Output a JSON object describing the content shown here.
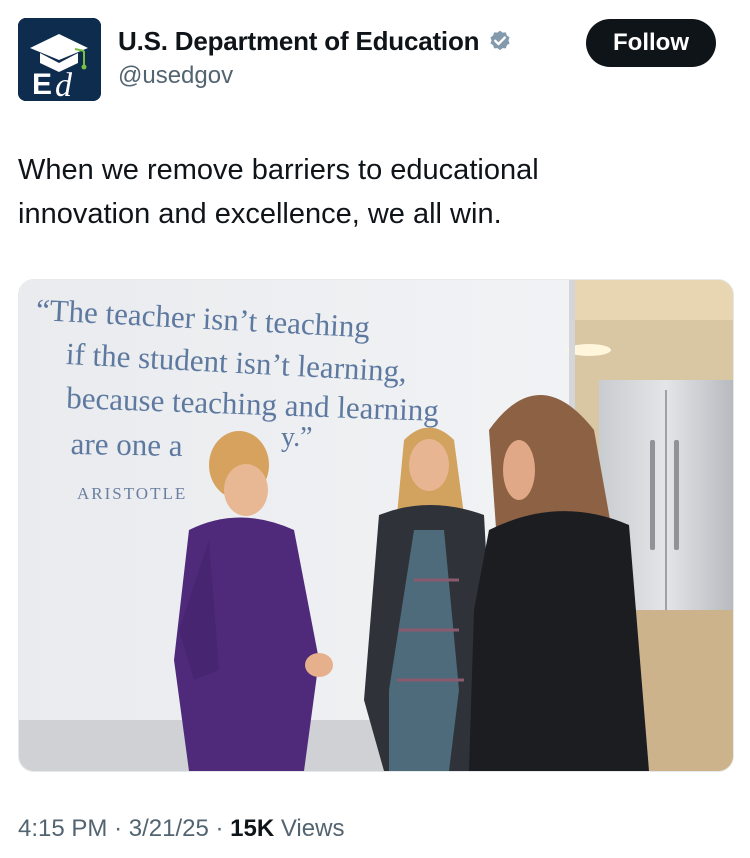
{
  "account": {
    "display_name": "U.S. Department of Education",
    "handle": "@usedgov",
    "avatar_icon": "ed-cap-logo-icon",
    "verified_icon": "verified-badge-icon",
    "verified_color": "#829aab"
  },
  "follow_label": "Follow",
  "tweet": {
    "text": "When we remove barriers to educational\ninnovation and excellence, we all win."
  },
  "media": {
    "quote_lines": [
      "“The teacher isn’t teaching",
      "if the student isn’t learning,",
      "because teaching and learning",
      "are one a"
    ],
    "quote_tail": "y.”",
    "quote_author": "ARISTOTLE"
  },
  "meta": {
    "time": "4:15 PM",
    "sep1": "·",
    "date": "3/21/25",
    "sep2": "·",
    "views_count": "15K",
    "views_label": "Views"
  },
  "colors": {
    "brand_navy": "#0e2c4e",
    "brand_green": "#77c043",
    "text_primary": "#0f1419",
    "text_secondary": "#536471"
  }
}
